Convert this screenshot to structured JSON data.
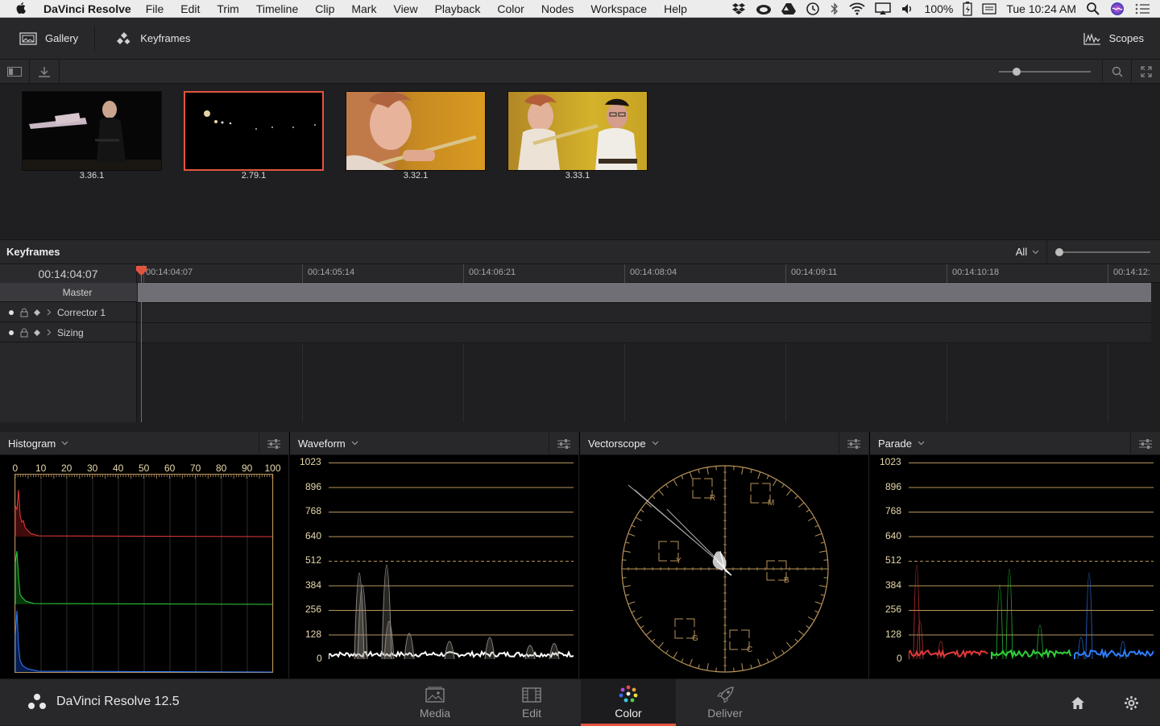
{
  "menubar": {
    "app_name": "DaVinci Resolve",
    "menus": [
      "File",
      "Edit",
      "Trim",
      "Timeline",
      "Clip",
      "Mark",
      "View",
      "Playback",
      "Color",
      "Nodes",
      "Workspace",
      "Help"
    ],
    "battery": "100%",
    "clock": "Tue 10:24 AM",
    "status_icons": [
      "dropbox-icon",
      "creative-cloud-icon",
      "google-drive-icon",
      "time-machine-icon",
      "bluetooth-icon",
      "wifi-icon",
      "airplay-icon",
      "volume-icon",
      "battery-icon",
      "input-menu-icon",
      "spotlight-icon",
      "siri-icon",
      "notification-center-icon"
    ]
  },
  "toolbar": {
    "gallery_label": "Gallery",
    "keyframes_label": "Keyframes",
    "scopes_label": "Scopes"
  },
  "gallery": {
    "stills": [
      {
        "label": "3.36.1",
        "selected": false
      },
      {
        "label": "2.79.1",
        "selected": true
      },
      {
        "label": "3.32.1",
        "selected": false
      },
      {
        "label": "3.33.1",
        "selected": false
      }
    ],
    "zoom_level": 0.19
  },
  "keyframes": {
    "title": "Keyframes",
    "filter": "All",
    "current_timecode": "00:14:04:07",
    "ruler": [
      "00:14:04:07",
      "00:14:05:14",
      "00:14:06:21",
      "00:14:08:04",
      "00:14:09:11",
      "00:14:10:18",
      "00:14:12:"
    ],
    "tracks": [
      {
        "label": "Master"
      },
      {
        "label": "Corrector 1"
      },
      {
        "label": "Sizing"
      }
    ]
  },
  "scopes": {
    "histogram": {
      "title": "Histogram",
      "x_ticks": [
        "0",
        "10",
        "20",
        "30",
        "40",
        "50",
        "60",
        "70",
        "80",
        "90",
        "100"
      ]
    },
    "waveform": {
      "title": "Waveform",
      "y_ticks": [
        "1023",
        "896",
        "768",
        "640",
        "512",
        "384",
        "256",
        "128",
        "0"
      ]
    },
    "vectorscope": {
      "title": "Vectorscope",
      "targets": [
        "R",
        "M",
        "Y",
        "B",
        "G",
        "C"
      ]
    },
    "parade": {
      "title": "Parade",
      "y_ticks": [
        "1023",
        "896",
        "768",
        "640",
        "512",
        "384",
        "256",
        "128",
        "0"
      ]
    },
    "colors": {
      "red": "#e23a3a",
      "green": "#2fcf3a",
      "blue": "#2f7fff",
      "graticule": "#b8935a"
    }
  },
  "bottom": {
    "product": "DaVinci Resolve 12.5",
    "pages": [
      {
        "label": "Media"
      },
      {
        "label": "Edit"
      },
      {
        "label": "Color"
      },
      {
        "label": "Deliver"
      }
    ],
    "active_page": "Color",
    "accent": "#e2543f"
  }
}
